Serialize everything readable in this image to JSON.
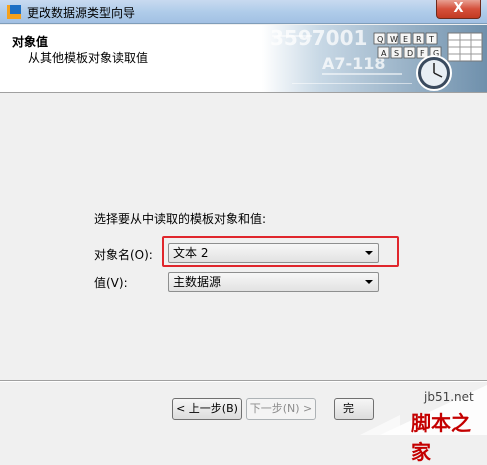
{
  "window": {
    "title": "更改数据源类型向导",
    "close_label": "X"
  },
  "header": {
    "title": "对象值",
    "subtitle": "从其他模板对象读取值"
  },
  "banner": {
    "number_text": "3597001",
    "code_text": "A7-118",
    "keys_row1": [
      "Q",
      "W",
      "E",
      "R",
      "T"
    ],
    "keys_row2": [
      "A",
      "S",
      "D",
      "F",
      "G"
    ]
  },
  "form": {
    "prompt": "选择要从中读取的模板对象和值:",
    "object_label": "对象名(O):",
    "object_value": "文本 2",
    "value_label": "值(V):",
    "value_value": "主数据源"
  },
  "buttons": {
    "back": "< 上一步(B)",
    "next": "下一步(N) >",
    "finish": "完"
  },
  "watermark": {
    "domain": "jb51.net",
    "name": "脚本之家"
  },
  "colors": {
    "highlight": "#e0262c",
    "watermark": "#c40000"
  }
}
